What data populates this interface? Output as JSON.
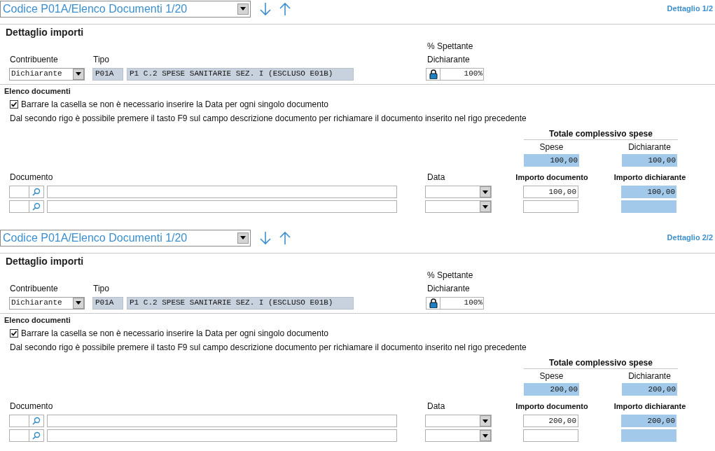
{
  "panels": [
    {
      "selector": "Codice P01A/Elenco Documenti 1/20",
      "detail_link": "Dettaglio 1/2",
      "section_title": "Dettaglio importi",
      "percent_header": "% Spettante",
      "contribuente_label": "Contribuente",
      "tipo_label": "Tipo",
      "percent_label": "Dichiarante",
      "contribuente": "Dichiarante",
      "tipo_code": "P01A",
      "tipo_description": "P1 C.2 SPESE SANITARIE SEZ. I (ESCLUSO E01B)",
      "percent": "100%",
      "locked": true,
      "documents_title": "Elenco documenti",
      "checkbox": {
        "label": "Barrare la casella se non è necessario inserire la Data per ogni singolo documento",
        "checked": true
      },
      "hint": "Dal secondo rigo è possibile premere il tasto F9 sul campo descrizione documento per richiamare il documento inserito nel rigo precedente",
      "totals": {
        "title": "Totale complessivo spese",
        "spese_label": "Spese",
        "dichiarante_label": "Dichiarante",
        "spese": "100,00",
        "dichiarante": "100,00"
      },
      "columns": {
        "documento": "Documento",
        "data": "Data",
        "importo": "Importo documento",
        "importo_dichiarante": "Importo dichiarante"
      },
      "rows": [
        {
          "importo": "100,00",
          "importo_dichiarante": "100,00"
        },
        {}
      ]
    },
    {
      "selector": "Codice P01A/Elenco Documenti 1/20",
      "detail_link": "Dettaglio 2/2",
      "section_title": "Dettaglio importi",
      "percent_header": "% Spettante",
      "contribuente_label": "Contribuente",
      "tipo_label": "Tipo",
      "percent_label": "Dichiarante",
      "contribuente": "Dichiarante",
      "tipo_code": "P01A",
      "tipo_description": "P1 C.2 SPESE SANITARIE SEZ. I (ESCLUSO E01B)",
      "percent": "100%",
      "locked": true,
      "documents_title": "Elenco documenti",
      "checkbox": {
        "label": "Barrare la casella se non è necessario inserire la Data per ogni singolo documento",
        "checked": true
      },
      "hint": "Dal secondo rigo è possibile premere il tasto F9 sul campo descrizione documento per richiamare il documento inserito nel rigo precedente",
      "totals": {
        "title": "Totale complessivo spese",
        "spese_label": "Spese",
        "dichiarante_label": "Dichiarante",
        "spese": "200,00",
        "dichiarante": "200,00"
      },
      "columns": {
        "documento": "Documento",
        "data": "Data",
        "importo": "Importo documento",
        "importo_dichiarante": "Importo dichiarante"
      },
      "rows": [
        {
          "importo": "200,00",
          "importo_dichiarante": "200,00"
        },
        {}
      ]
    }
  ]
}
